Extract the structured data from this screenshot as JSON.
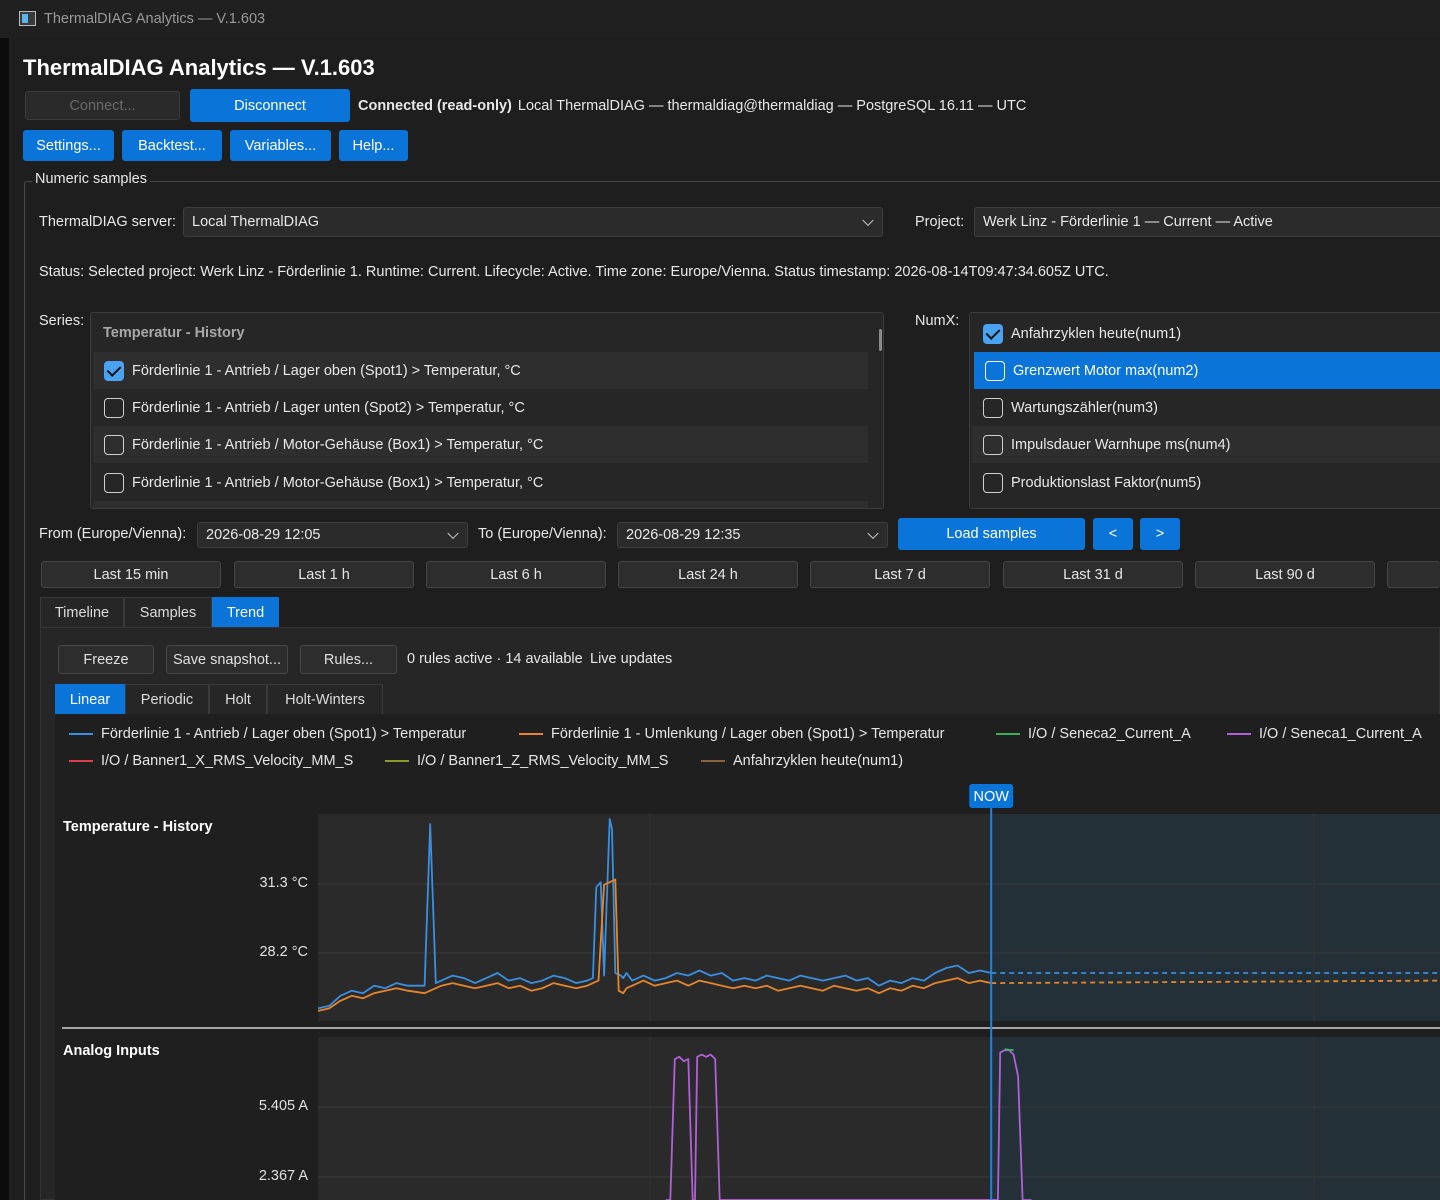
{
  "window": {
    "title": "ThermalDIAG Analytics — V.1.603"
  },
  "header": {
    "title": "ThermalDIAG Analytics — V.1.603"
  },
  "connection": {
    "connect_label": "Connect...",
    "disconnect_label": "Disconnect",
    "status_bold": "Connected (read-only)",
    "status_detail": "Local ThermalDIAG — thermaldiag@thermaldiag — PostgreSQL 16.11 — UTC"
  },
  "toolbar": {
    "settings": "Settings...",
    "backtest": "Backtest...",
    "variables": "Variables...",
    "help": "Help..."
  },
  "group": {
    "title": "Numeric samples"
  },
  "server": {
    "label": "ThermalDIAG server:",
    "value": "Local ThermalDIAG"
  },
  "project": {
    "label": "Project:",
    "value": "Werk Linz - Förderlinie 1 — Current — Active"
  },
  "status": {
    "text": "Status:  Selected project: Werk Linz - Förderlinie 1. Runtime: Current. Lifecycle: Active. Time zone: Europe/Vienna. Status timestamp: 2026-08-14T09:47:34.605Z UTC."
  },
  "series": {
    "label": "Series:",
    "group_header": "Temperatur - History",
    "items": [
      {
        "label": "Förderlinie 1 - Antrieb / Lager oben (Spot1) > Temperatur, °C",
        "checked": true
      },
      {
        "label": "Förderlinie 1 - Antrieb / Lager unten (Spot2) > Temperatur, °C",
        "checked": false
      },
      {
        "label": "Förderlinie 1 - Antrieb / Motor-Gehäuse (Box1) > Temperatur, °C",
        "checked": false
      },
      {
        "label": "Förderlinie 1 - Antrieb / Motor-Gehäuse (Box1) > Temperatur, °C",
        "checked": false
      }
    ]
  },
  "numx": {
    "label": "NumX:",
    "items": [
      {
        "label": "Anfahrzyklen heute(num1)",
        "checked": true
      },
      {
        "label": "Grenzwert Motor max(num2)",
        "checked": false,
        "selected": true
      },
      {
        "label": "Wartungszähler(num3)",
        "checked": false
      },
      {
        "label": "Impulsdauer Warnhupe ms(num4)",
        "checked": false
      },
      {
        "label": "Produktionslast Faktor(num5)",
        "checked": false
      }
    ]
  },
  "range": {
    "from_label": "From (Europe/Vienna):",
    "from_value": "2026-08-29 12:05",
    "to_label": "To (Europe/Vienna):",
    "to_value": "2026-08-29 12:35",
    "load_label": "Load samples",
    "prev_label": "<",
    "next_label": ">"
  },
  "quick_ranges": [
    "Last 15 min",
    "Last 1 h",
    "Last 6 h",
    "Last 24 h",
    "Last 7 d",
    "Last 31 d",
    "Last 90 d",
    ""
  ],
  "tabs": [
    "Timeline",
    "Samples",
    "Trend"
  ],
  "active_tab": "Trend",
  "trend": {
    "freeze": "Freeze",
    "save": "Save snapshot...",
    "rules": "Rules...",
    "rules_status": "0 rules active · 14 available",
    "live": "Live updates",
    "subtabs": [
      "Linear",
      "Periodic",
      "Holt",
      "Holt-Winters"
    ],
    "active_subtab": "Linear",
    "now_label": "NOW"
  },
  "legend": [
    {
      "label": "Förderlinie 1 - Antrieb / Lager oben (Spot1) > Temperatur",
      "color": "#3a8fe0"
    },
    {
      "label": "Förderlinie 1 - Umlenkung / Lager oben (Spot1) > Temperatur",
      "color": "#e6862c"
    },
    {
      "label": "I/O / Seneca2_Current_A",
      "color": "#3fae5a"
    },
    {
      "label": "I/O / Seneca1_Current_A",
      "color": "#b060d8"
    },
    {
      "label": "I/O / Banner1_X_RMS_Velocity_MM_S",
      "color": "#d8404a"
    },
    {
      "label": "I/O / Banner1_Z_RMS_Velocity_MM_S",
      "color": "#8c9a26"
    },
    {
      "label": "Anfahrzyklen heute(num1)",
      "color": "#8a6440"
    }
  ],
  "colors": {
    "accent": "#0a74d8",
    "background": "#1e1e1e"
  },
  "chart_data": [
    {
      "type": "line",
      "title": "Temperature - History",
      "yticks": [
        "31.3 °C",
        "28.2 °C"
      ],
      "ytick_values": [
        31.3,
        28.2
      ],
      "ylim": [
        25.4,
        33.6
      ],
      "xlim": [
        0,
        1
      ],
      "now_x": 0.6,
      "series": [
        {
          "name": "Förderlinie 1 - Antrieb / Lager oben (Spot1) > Temperatur",
          "color": "#3a8fe0",
          "x": [
            0,
            0.01,
            0.02,
            0.03,
            0.04,
            0.05,
            0.06,
            0.07,
            0.08,
            0.095,
            0.1,
            0.105,
            0.11,
            0.12,
            0.13,
            0.14,
            0.15,
            0.16,
            0.17,
            0.18,
            0.19,
            0.2,
            0.21,
            0.22,
            0.23,
            0.24,
            0.245,
            0.248,
            0.252,
            0.255,
            0.26,
            0.262,
            0.265,
            0.27,
            0.272,
            0.275,
            0.28,
            0.29,
            0.3,
            0.31,
            0.32,
            0.33,
            0.34,
            0.35,
            0.36,
            0.37,
            0.38,
            0.39,
            0.4,
            0.41,
            0.42,
            0.43,
            0.44,
            0.45,
            0.46,
            0.47,
            0.48,
            0.49,
            0.5,
            0.51,
            0.52,
            0.53,
            0.54,
            0.55,
            0.56,
            0.57,
            0.58,
            0.59,
            0.6
          ],
          "values": [
            25.9,
            26.0,
            26.4,
            26.6,
            26.5,
            26.8,
            26.7,
            26.9,
            26.8,
            26.8,
            33.2,
            26.9,
            27.0,
            27.2,
            27.1,
            26.9,
            27.1,
            27.3,
            27.0,
            27.1,
            26.9,
            27.0,
            27.2,
            27.1,
            26.9,
            27.0,
            27.1,
            30.7,
            30.9,
            27.2,
            33.4,
            33.0,
            27.3,
            27.2,
            27.1,
            27.3,
            27.0,
            27.2,
            27.0,
            27.1,
            27.3,
            27.2,
            27.4,
            27.2,
            27.3,
            27.0,
            27.1,
            27.0,
            27.2,
            27.1,
            27.0,
            27.2,
            27.1,
            27.0,
            27.1,
            27.2,
            27.0,
            27.1,
            26.8,
            27.0,
            26.9,
            27.1,
            27.0,
            27.3,
            27.5,
            27.6,
            27.3,
            27.4,
            27.3
          ]
        },
        {
          "name": "Förderlinie 1 - Umlenkung / Lager oben (Spot1) > Temperatur",
          "color": "#e6862c",
          "x": [
            0,
            0.01,
            0.02,
            0.03,
            0.04,
            0.05,
            0.06,
            0.07,
            0.08,
            0.095,
            0.1,
            0.105,
            0.11,
            0.12,
            0.13,
            0.14,
            0.15,
            0.16,
            0.17,
            0.18,
            0.19,
            0.2,
            0.21,
            0.22,
            0.23,
            0.24,
            0.245,
            0.25,
            0.255,
            0.26,
            0.265,
            0.268,
            0.272,
            0.275,
            0.28,
            0.29,
            0.3,
            0.31,
            0.32,
            0.33,
            0.34,
            0.35,
            0.36,
            0.37,
            0.38,
            0.39,
            0.4,
            0.41,
            0.42,
            0.43,
            0.44,
            0.45,
            0.46,
            0.47,
            0.48,
            0.49,
            0.5,
            0.51,
            0.52,
            0.53,
            0.54,
            0.55,
            0.56,
            0.57,
            0.58,
            0.59,
            0.6
          ],
          "values": [
            25.8,
            25.9,
            26.2,
            26.4,
            26.3,
            26.5,
            26.6,
            26.7,
            26.6,
            26.5,
            26.6,
            26.7,
            26.8,
            26.9,
            26.8,
            26.7,
            26.8,
            26.9,
            26.7,
            26.8,
            26.6,
            26.7,
            26.9,
            26.8,
            26.7,
            26.8,
            26.9,
            27.0,
            30.8,
            30.9,
            31.0,
            26.6,
            26.5,
            26.7,
            26.8,
            27.0,
            26.8,
            26.9,
            27.0,
            26.8,
            27.0,
            26.9,
            26.8,
            26.7,
            26.8,
            26.7,
            26.8,
            26.6,
            26.7,
            26.8,
            26.7,
            26.6,
            26.8,
            26.7,
            26.6,
            26.7,
            26.5,
            26.7,
            26.6,
            26.8,
            26.7,
            26.9,
            27.0,
            27.1,
            26.9,
            27.0,
            26.9
          ]
        }
      ],
      "forecast": [
        {
          "name": "Förderlinie 1 - Antrieb / Lager oben (Spot1) > Temperatur",
          "color": "#3a8fe0",
          "x": [
            0.6,
            1.0
          ],
          "values": [
            27.3,
            27.3
          ]
        },
        {
          "name": "Förderlinie 1 - Umlenkung / Lager oben (Spot1) > Temperatur",
          "color": "#e6862c",
          "x": [
            0.6,
            1.0
          ],
          "values": [
            26.9,
            27.0
          ]
        }
      ]
    },
    {
      "type": "line",
      "title": "Analog Inputs",
      "yticks": [
        "5.405 A",
        "2.367 A"
      ],
      "ytick_values": [
        5.405,
        2.367
      ],
      "ylim": [
        0.0,
        7.4
      ],
      "xlim": [
        0,
        1
      ],
      "series": [
        {
          "name": "I/O / Seneca1_Current_A",
          "color": "#b060d8",
          "x": [
            0.31,
            0.314,
            0.318,
            0.322,
            0.326,
            0.33,
            0.334,
            0.336,
            0.338,
            0.342,
            0.346,
            0.35,
            0.354,
            0.358,
            0.364,
            0.367,
            0.368,
            0.37,
            0.372,
            0.374,
            0.376,
            0.606,
            0.608,
            0.612,
            0.616,
            0.62,
            0.624,
            0.628,
            0.632,
            0.636
          ],
          "values": [
            0.0,
            0.0,
            6.4,
            6.5,
            6.3,
            6.4,
            0.0,
            0.0,
            6.5,
            6.6,
            6.5,
            6.6,
            6.4,
            0.0,
            0.0,
            0.0,
            0.0,
            0.0,
            0.0,
            0.0,
            0.0,
            0.0,
            6.7,
            6.8,
            6.8,
            6.6,
            5.6,
            0.0,
            0.0,
            0.0
          ]
        },
        {
          "name": "I/O / Seneca2_Current_A",
          "color": "#3fae5a",
          "x": [
            0.612,
            0.616,
            0.62
          ],
          "values": [
            6.85,
            6.82,
            6.8
          ]
        }
      ]
    }
  ]
}
